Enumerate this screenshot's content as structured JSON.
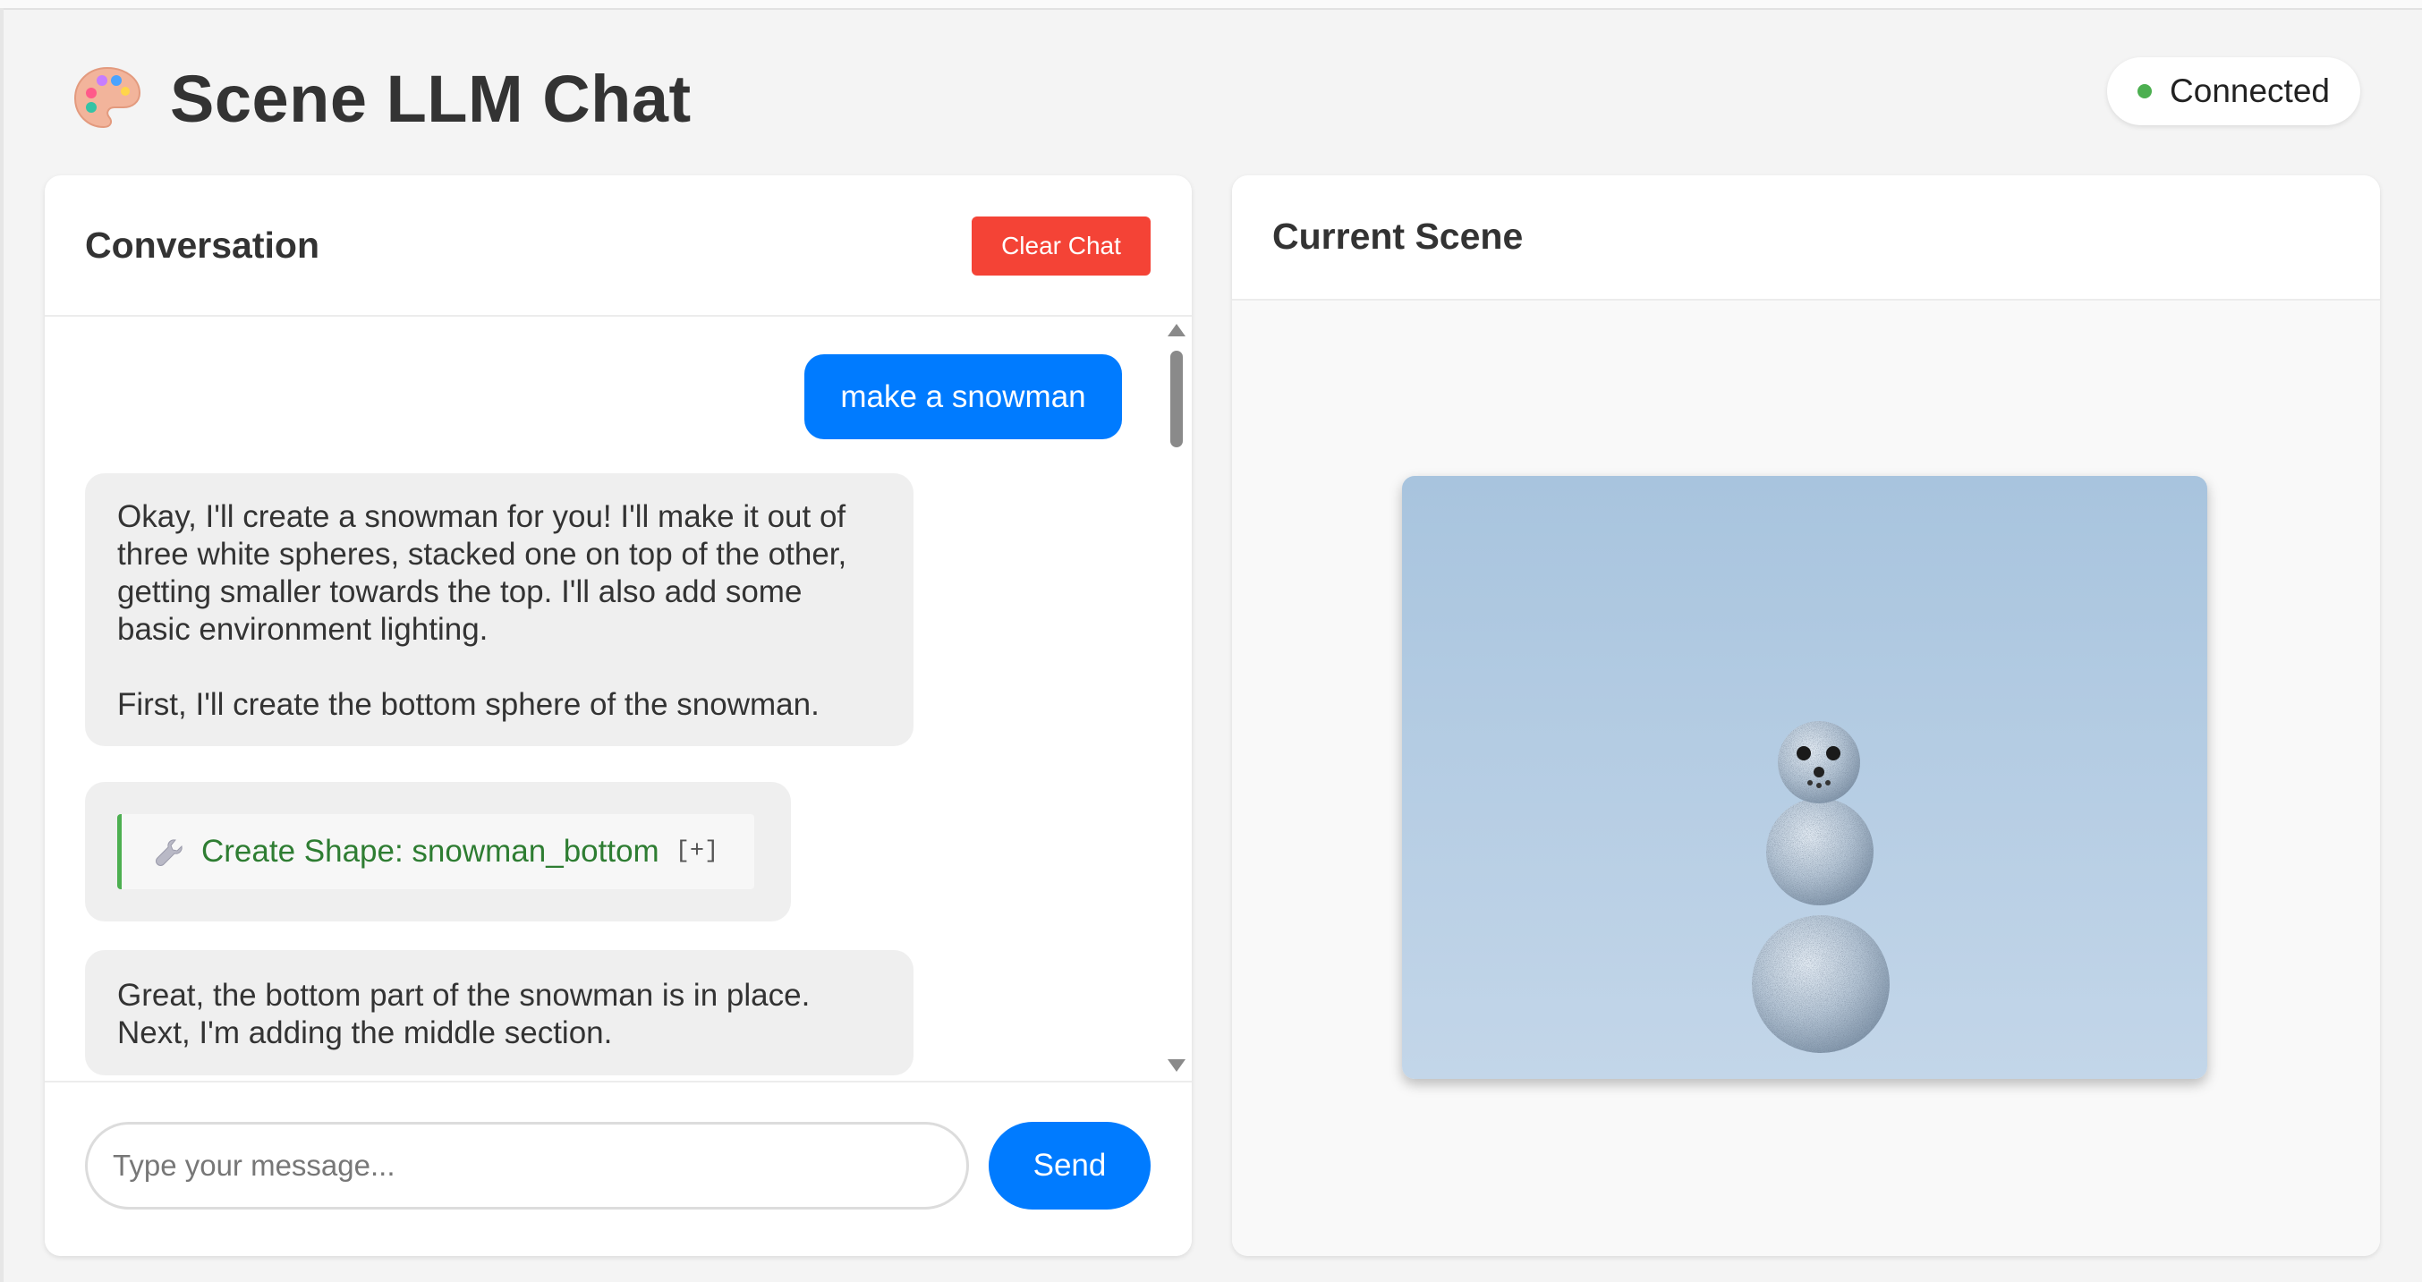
{
  "app": {
    "title": "Scene LLM Chat",
    "icon": "palette-icon"
  },
  "status": {
    "text": "Connected",
    "color": "#4caf50"
  },
  "chat": {
    "title": "Conversation",
    "clear_label": "Clear Chat",
    "messages": [
      {
        "role": "user",
        "text": "make a snowman"
      },
      {
        "role": "assistant",
        "lines": [
          "Okay, I'll create a snowman for you! I'll make it out of",
          "three white spheres, stacked one on top of the other,",
          "getting smaller towards the top. I'll also add some",
          "basic environment lighting."
        ],
        "text2": "First, I'll create the bottom sphere of the snowman."
      },
      {
        "role": "tool",
        "icon": "wrench-icon",
        "label": "Create Shape: snowman_bottom",
        "expand": "[+]"
      },
      {
        "role": "assistant",
        "lines": [
          "Great, the bottom part of the snowman is in place.",
          "Next, I'm adding the middle section."
        ]
      }
    ],
    "input_placeholder": "Type your message...",
    "send_label": "Send"
  },
  "scene": {
    "title": "Current Scene",
    "background_top": "#a8c4de",
    "background_bottom": "#c3d6e9"
  },
  "colors": {
    "accent": "#007bff",
    "danger": "#f44336",
    "tool": "#4caf50"
  }
}
